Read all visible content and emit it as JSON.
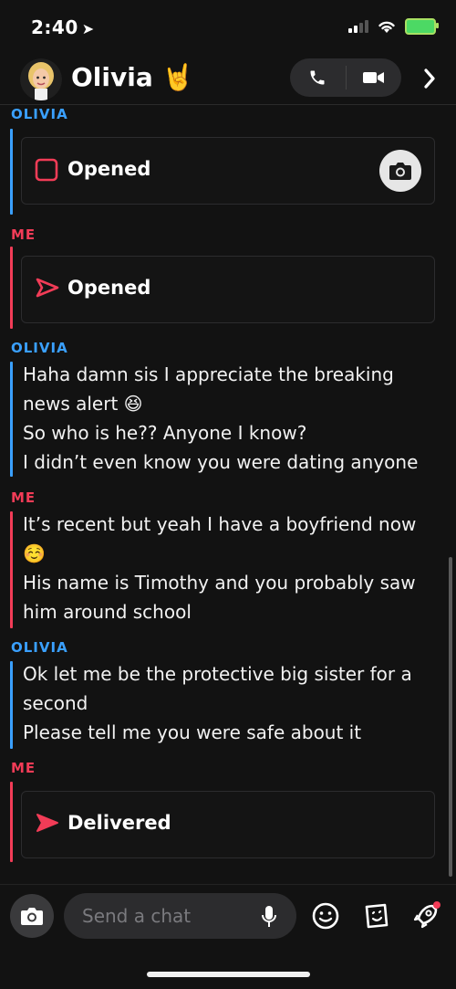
{
  "status_bar": {
    "time": "2:40"
  },
  "header": {
    "contact_name": "Olivia 🤘"
  },
  "messages": [
    {
      "sender": "OLIVIA",
      "type": "snap",
      "label": "Opened"
    },
    {
      "sender": "ME",
      "type": "snap",
      "label": "Opened"
    },
    {
      "sender": "OLIVIA",
      "type": "text",
      "lines": [
        "Haha damn sis I appreciate the breaking",
        "news alert 😆",
        "So who is he?? Anyone I know?",
        "I didn’t even know you were dating anyone"
      ]
    },
    {
      "sender": "ME",
      "type": "text",
      "lines": [
        "It’s recent but yeah I have a boyfriend now",
        "☺️",
        "His name is Timothy and you probably saw",
        "him around school"
      ]
    },
    {
      "sender": "OLIVIA",
      "type": "text",
      "lines": [
        "Ok let me be the protective big sister for a",
        "second",
        "Please tell me you were safe about it"
      ]
    },
    {
      "sender": "ME",
      "type": "snap",
      "label": "Delivered"
    }
  ],
  "input": {
    "placeholder": "Send a chat"
  },
  "colors": {
    "olivia": "#3aa0ff",
    "me": "#f23c57",
    "background": "#121212"
  },
  "icons": [
    "location-arrow-icon",
    "signal-icon",
    "wifi-icon",
    "battery-charging-icon",
    "phone-icon",
    "video-icon",
    "chevron-right-icon",
    "camera-icon",
    "microphone-icon",
    "smiley-icon",
    "sticker-icon",
    "rocket-icon"
  ]
}
